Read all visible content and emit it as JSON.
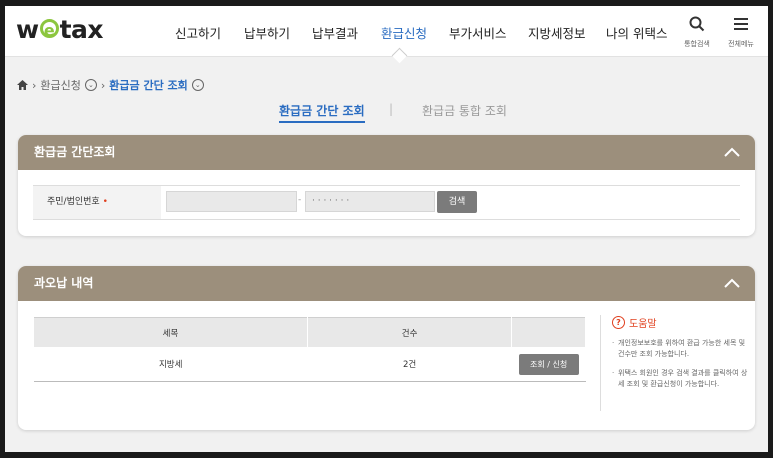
{
  "header": {
    "logo": {
      "prefix": "w",
      "mid": "e",
      "suffix": "tax"
    },
    "nav": [
      {
        "label": "신고하기"
      },
      {
        "label": "납부하기"
      },
      {
        "label": "납부결과"
      },
      {
        "label": "환급신청",
        "active": true
      },
      {
        "label": "부가서비스"
      },
      {
        "label": "지방세정보"
      },
      {
        "label": "나의 위택스"
      }
    ],
    "search_label": "통합검색",
    "menu_label": "전체메뉴"
  },
  "breadcrumb": {
    "home_icon": "home-icon",
    "items": [
      "환급신청",
      "환급금 간단 조회"
    ]
  },
  "subtabs": {
    "active": "환급금 간단 조회",
    "separator": "|",
    "other": "환급금 통합 조회"
  },
  "panel1": {
    "title": "환급금 간단조회",
    "field_label": "주민/법인번호",
    "required_mark": "•",
    "field1_value": "",
    "dash": "-",
    "field2_value": "· · · · · · ·",
    "search_button": "검색"
  },
  "panel2": {
    "title": "과오납 내역",
    "table": {
      "headers": [
        "세목",
        "건수",
        ""
      ],
      "rows": [
        {
          "tax": "지방세",
          "count": "2건",
          "action": "조회 / 신청"
        }
      ]
    },
    "help": {
      "title": "도움말",
      "items": [
        "개인정보보호를 위하여 환급 가능한 세목 및 건수만 조회 가능합니다.",
        "위택스 회원인 경우 검색 결과를 클릭하여 상세 조회 및 환급신청이 가능합니다."
      ]
    }
  },
  "colors": {
    "accent": "#2a6cc1",
    "panel_header": "#9c8f7c",
    "required": "#e0401f",
    "logo_e": "#8cc63f"
  }
}
